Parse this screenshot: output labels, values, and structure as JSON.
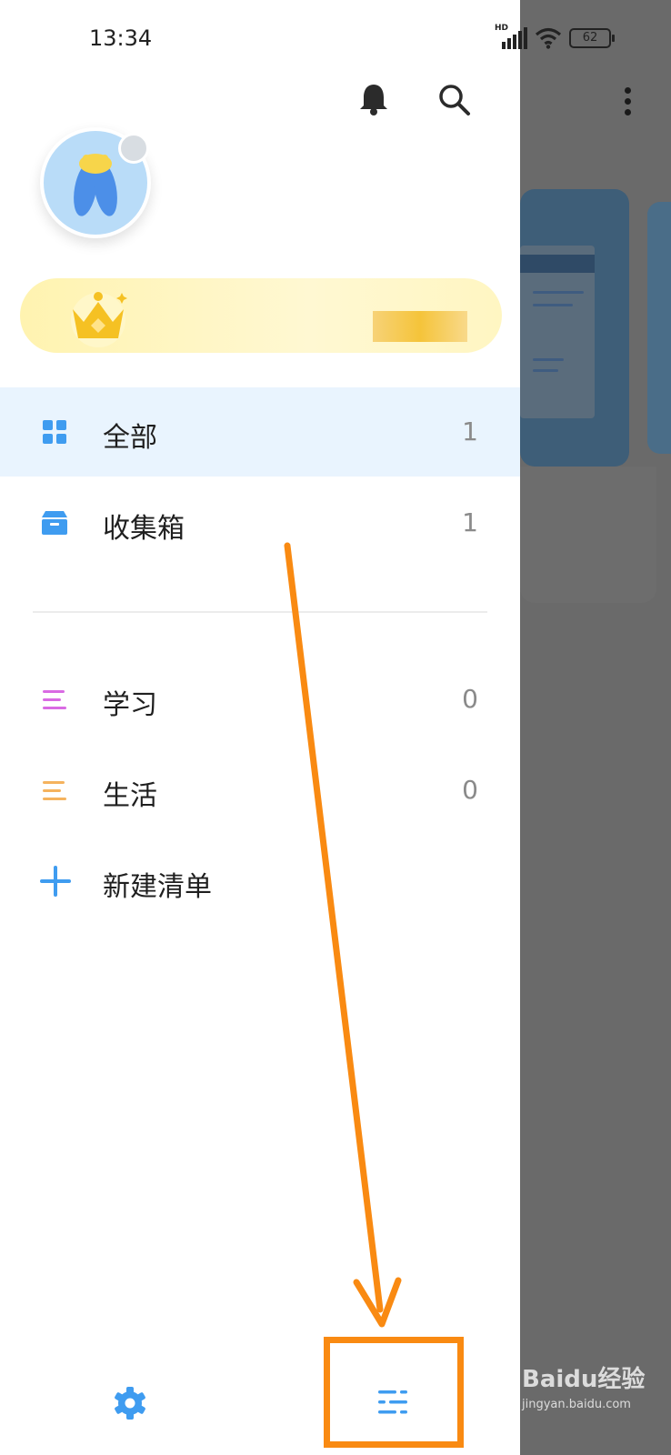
{
  "status_bar": {
    "time": "13:34",
    "network": "HD",
    "battery": "62"
  },
  "drawer": {
    "header": {
      "bell_icon": "bell-icon",
      "search_icon": "search-icon"
    },
    "profile": {
      "avatar_icon": "cicada-avatar",
      "badge_icon": "crown-badge-icon"
    },
    "vip": {
      "crown_icon": "crown-icon"
    },
    "nav": [
      {
        "label": "全部",
        "count": "1",
        "icon": "grid-icon",
        "active": true
      },
      {
        "label": "收集箱",
        "count": "1",
        "icon": "inbox-icon",
        "active": false
      }
    ],
    "lists": [
      {
        "label": "学习",
        "count": "0",
        "icon": "list-lines-icon",
        "color": "#d96be3"
      },
      {
        "label": "生活",
        "count": "0",
        "icon": "list-lines-icon",
        "color": "#f5b35e"
      }
    ],
    "new_list_label": "新建清单",
    "footer": {
      "settings_icon": "gear-icon",
      "manage_icon": "list-settings-icon"
    }
  },
  "overlay": {
    "watermark_text": "Baidu经验",
    "watermark_url": "jingyan.baidu.com"
  },
  "colors": {
    "accent": "#3f9cf0",
    "active_bg": "#e9f4fe",
    "annotation": "#f98a12",
    "overlay": "#6a6a6a"
  }
}
